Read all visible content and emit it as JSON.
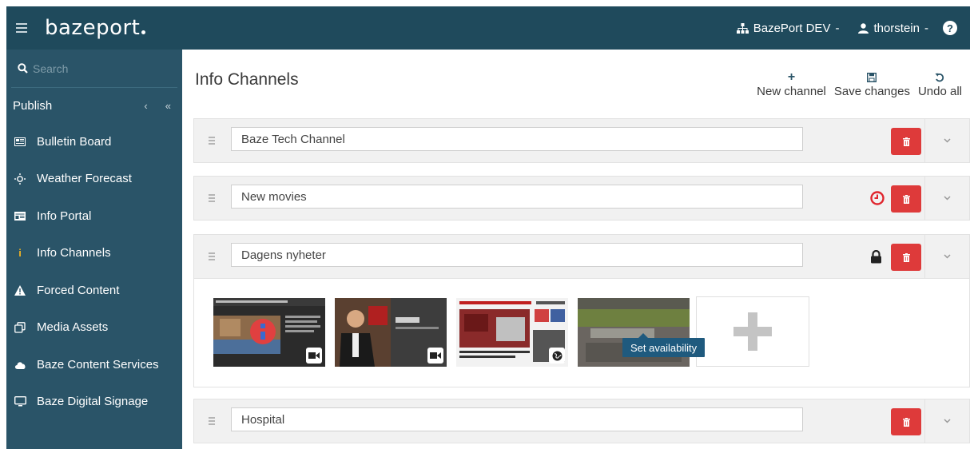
{
  "app": {
    "logo": "bazeport",
    "tenant_label": "BazePort DEV",
    "user_label": "thorstein",
    "caret": "-"
  },
  "sidebar": {
    "search_placeholder": "Search",
    "section": "Publish",
    "collapse_glyph": "‹",
    "collapse_all_glyph": "«",
    "items": [
      {
        "label": "Bulletin Board",
        "icon": "bulletin-board-icon"
      },
      {
        "label": "Weather Forecast",
        "icon": "weather-icon"
      },
      {
        "label": "Info Portal",
        "icon": "portal-icon"
      },
      {
        "label": "Info Channels",
        "icon": "info-icon",
        "active": true
      },
      {
        "label": "Forced Content",
        "icon": "warning-icon"
      },
      {
        "label": "Media Assets",
        "icon": "media-assets-icon"
      },
      {
        "label": "Baze Content Services",
        "icon": "cloud-icon"
      },
      {
        "label": "Baze Digital Signage",
        "icon": "monitor-icon"
      }
    ]
  },
  "main": {
    "title": "Info Channels",
    "toolbar": {
      "new_channel": "New channel",
      "save_changes": "Save changes",
      "undo_all": "Undo all"
    },
    "channels": [
      {
        "name": "Baze Tech Channel",
        "status_icon": ""
      },
      {
        "name": "New movies",
        "status_icon": "clock-icon"
      },
      {
        "name": "Dagens nyheter",
        "status_icon": "lock-icon"
      },
      {
        "name": "Hospital",
        "status_icon": ""
      }
    ],
    "tooltip": "Set availability"
  },
  "colors": {
    "topbar": "#1f4a5c",
    "sidebar": "#2a5468",
    "danger": "#de3a3a",
    "accent": "#f0b323"
  }
}
